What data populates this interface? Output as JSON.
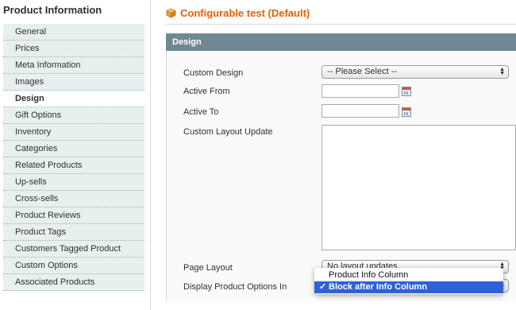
{
  "sidebar": {
    "title": "Product Information",
    "items": [
      {
        "label": "General",
        "active": false
      },
      {
        "label": "Prices",
        "active": false
      },
      {
        "label": "Meta Information",
        "active": false
      },
      {
        "label": "Images",
        "active": false
      },
      {
        "label": "Design",
        "active": true
      },
      {
        "label": "Gift Options",
        "active": false
      },
      {
        "label": "Inventory",
        "active": false
      },
      {
        "label": "Categories",
        "active": false
      },
      {
        "label": "Related Products",
        "active": false
      },
      {
        "label": "Up-sells",
        "active": false
      },
      {
        "label": "Cross-sells",
        "active": false
      },
      {
        "label": "Product Reviews",
        "active": false
      },
      {
        "label": "Product Tags",
        "active": false
      },
      {
        "label": "Customers Tagged Product",
        "active": false
      },
      {
        "label": "Custom Options",
        "active": false
      },
      {
        "label": "Associated Products",
        "active": false
      }
    ]
  },
  "main": {
    "title": "Configurable test (Default)",
    "title_icon": "cube-icon",
    "section_title": "Design",
    "fields": {
      "custom_design": {
        "label": "Custom Design",
        "value": "-- Please Select --"
      },
      "active_from": {
        "label": "Active From",
        "value": ""
      },
      "active_to": {
        "label": "Active To",
        "value": ""
      },
      "custom_layout_update": {
        "label": "Custom Layout Update",
        "value": ""
      },
      "page_layout": {
        "label": "Page Layout",
        "value": "No layout updates"
      },
      "display_product_options_in": {
        "label": "Display Product Options In",
        "options": [
          "Product Info Column",
          "Block after Info Column"
        ],
        "selected": "Block after Info Column"
      }
    }
  },
  "colors": {
    "title_orange": "#eb5e00",
    "section_header": "#6f8992",
    "sidebar_bg": "#e7efef",
    "selected_option": "#2f62d6"
  }
}
